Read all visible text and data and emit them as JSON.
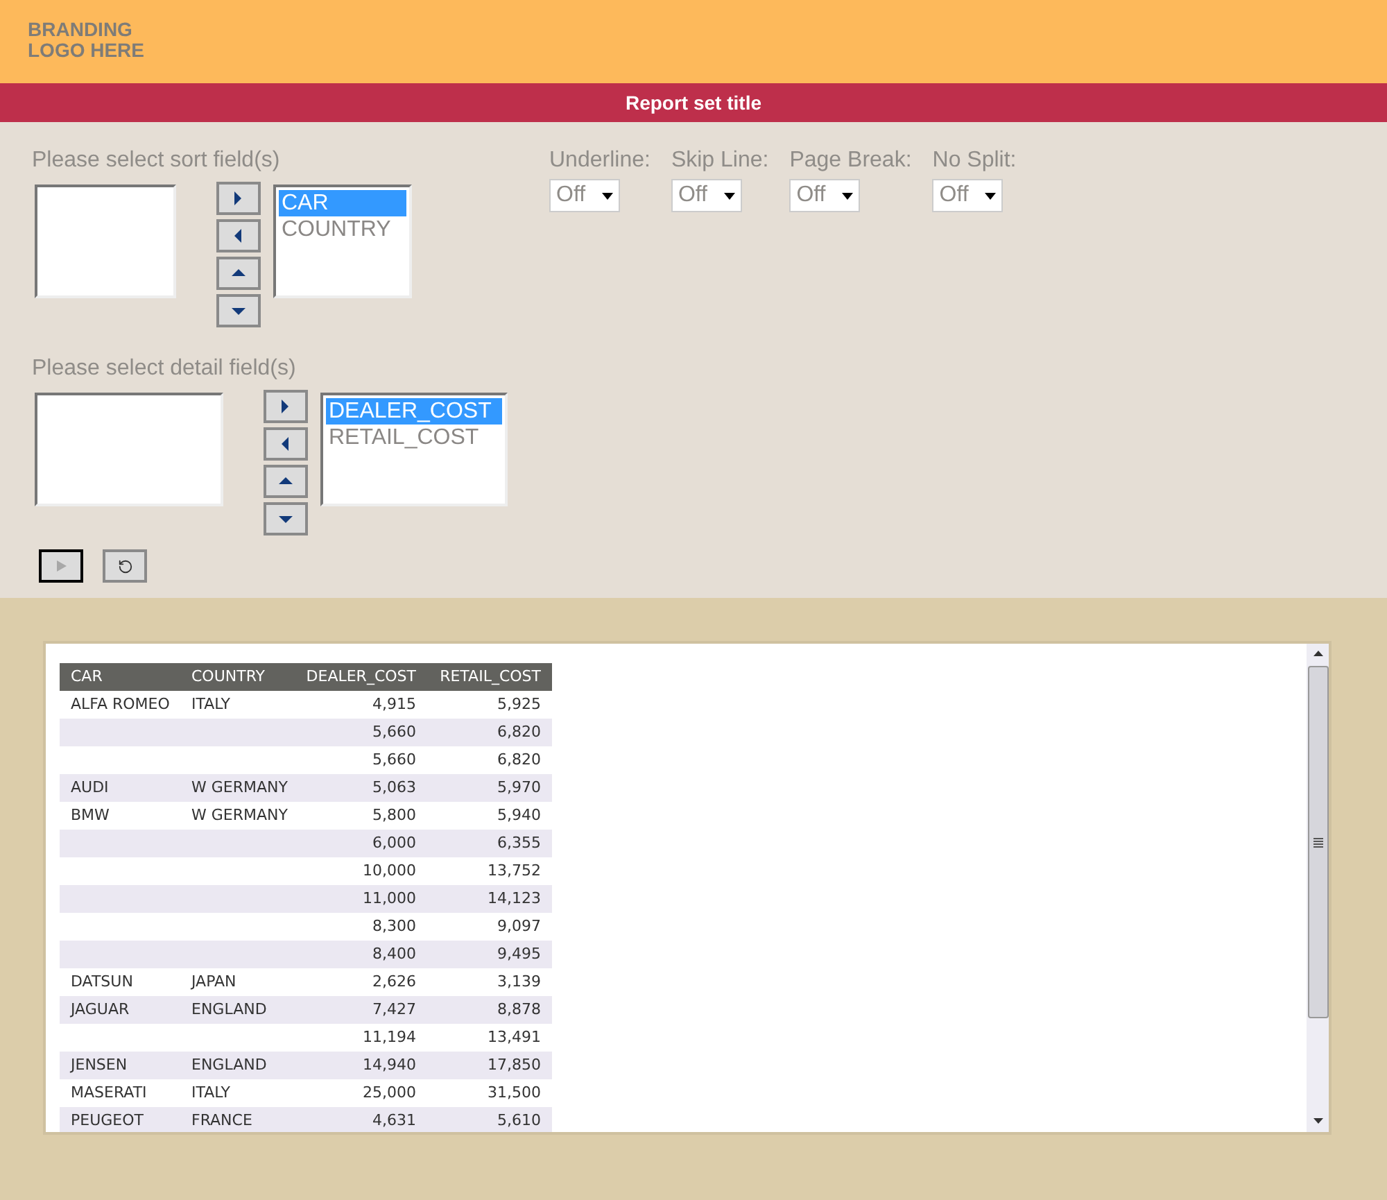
{
  "header": {
    "logo_lines": [
      "BRANDING",
      "LOGO HERE"
    ]
  },
  "title_bar": {
    "title": "Report set title"
  },
  "sort_fields": {
    "label": "Please select sort field(s)",
    "chosen": [
      {
        "label": "CAR",
        "selected": true
      },
      {
        "label": "COUNTRY",
        "selected": false
      }
    ]
  },
  "detail_fields": {
    "label": "Please select detail field(s)",
    "chosen": [
      {
        "label": "DEALER_COST",
        "selected": true
      },
      {
        "label": "RETAIL_COST",
        "selected": false
      }
    ]
  },
  "options": [
    {
      "label": "Underline:",
      "value": "Off"
    },
    {
      "label": "Skip Line:",
      "value": "Off"
    },
    {
      "label": "Page Break:",
      "value": "Off"
    },
    {
      "label": "No Split:",
      "value": "Off"
    }
  ],
  "table": {
    "columns": [
      {
        "label": "CAR",
        "kind": "text"
      },
      {
        "label": "COUNTRY",
        "kind": "text"
      },
      {
        "label": "DEALER_COST",
        "kind": "number"
      },
      {
        "label": "RETAIL_COST",
        "kind": "number"
      }
    ],
    "rows": [
      [
        "ALFA ROMEO",
        "ITALY",
        "4,915",
        "5,925"
      ],
      [
        "",
        "",
        "5,660",
        "6,820"
      ],
      [
        "",
        "",
        "5,660",
        "6,820"
      ],
      [
        "AUDI",
        "W GERMANY",
        "5,063",
        "5,970"
      ],
      [
        "BMW",
        "W GERMANY",
        "5,800",
        "5,940"
      ],
      [
        "",
        "",
        "6,000",
        "6,355"
      ],
      [
        "",
        "",
        "10,000",
        "13,752"
      ],
      [
        "",
        "",
        "11,000",
        "14,123"
      ],
      [
        "",
        "",
        "8,300",
        "9,097"
      ],
      [
        "",
        "",
        "8,400",
        "9,495"
      ],
      [
        "DATSUN",
        "JAPAN",
        "2,626",
        "3,139"
      ],
      [
        "JAGUAR",
        "ENGLAND",
        "7,427",
        "8,878"
      ],
      [
        "",
        "",
        "11,194",
        "13,491"
      ],
      [
        "JENSEN",
        "ENGLAND",
        "14,940",
        "17,850"
      ],
      [
        "MASERATI",
        "ITALY",
        "25,000",
        "31,500"
      ],
      [
        "PEUGEOT",
        "FRANCE",
        "4,631",
        "5,610"
      ]
    ]
  }
}
